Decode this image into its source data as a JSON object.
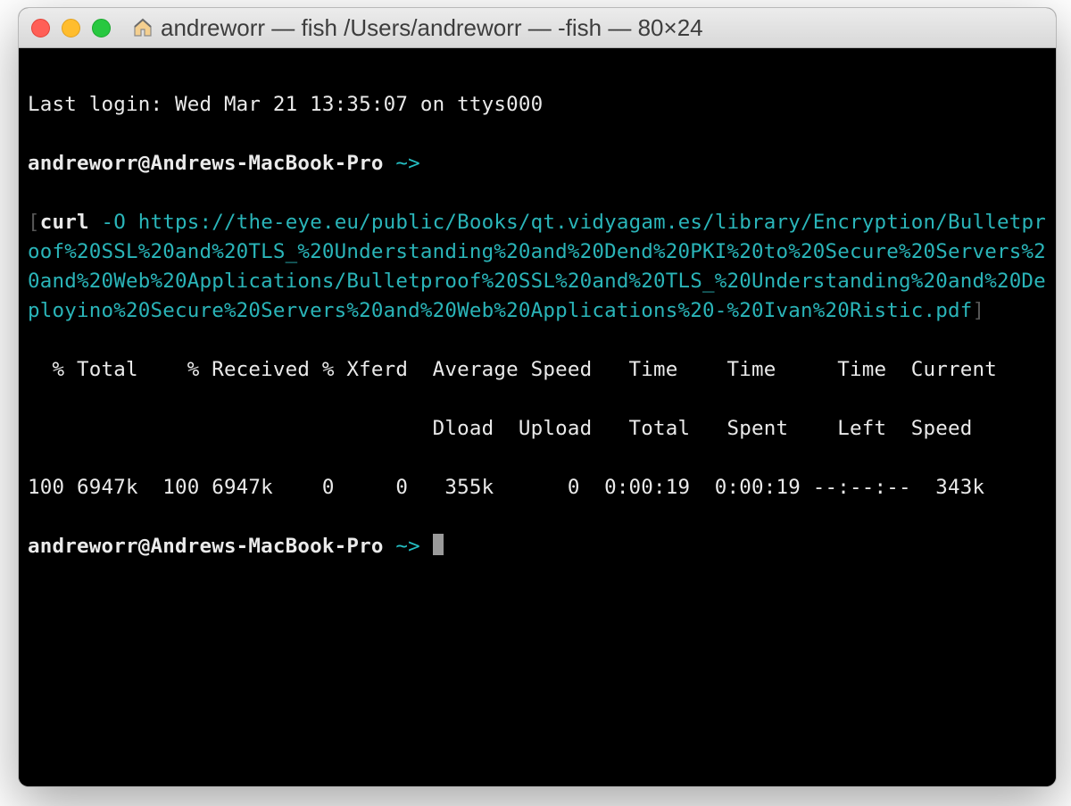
{
  "window": {
    "title": "andreworr — fish  /Users/andreworr — -fish — 80×24"
  },
  "terminal": {
    "last_login": "Last login: Wed Mar 21 13:35:07 on ttys000",
    "prompt1_user": "andreworr@Andrews-MacBook-Pro ",
    "prompt1_tilde": "~>",
    "cmd_bracket_open": "[",
    "cmd_name": "curl",
    "cmd_flag": " -O ",
    "cmd_url": "https://the-eye.eu/public/Books/qt.vidyagam.es/library/Encryption/Bulletproof%20SSL%20and%20TLS_%20Understanding%20and%20Dend%20PKI%20to%20Secure%20Servers%20and%20Web%20Applications/Bulletproof%20SSL%20and%20TLS_%20Understanding%20and%20Deployino%20Secure%20Servers%20and%20Web%20Applications%20-%20Ivan%20Ristic.pdf",
    "cmd_bracket_close": "]",
    "header1": "  % Total    % Received % Xferd  Average Speed   Time    Time     Time  Current",
    "header2": "                                 Dload  Upload   Total   Spent    Left  Speed",
    "values": "100 6947k  100 6947k    0     0   355k      0  0:00:19  0:00:19 --:--:--  343k",
    "prompt2_user": "andreworr@Andrews-MacBook-Pro ",
    "prompt2_tilde": "~> "
  }
}
